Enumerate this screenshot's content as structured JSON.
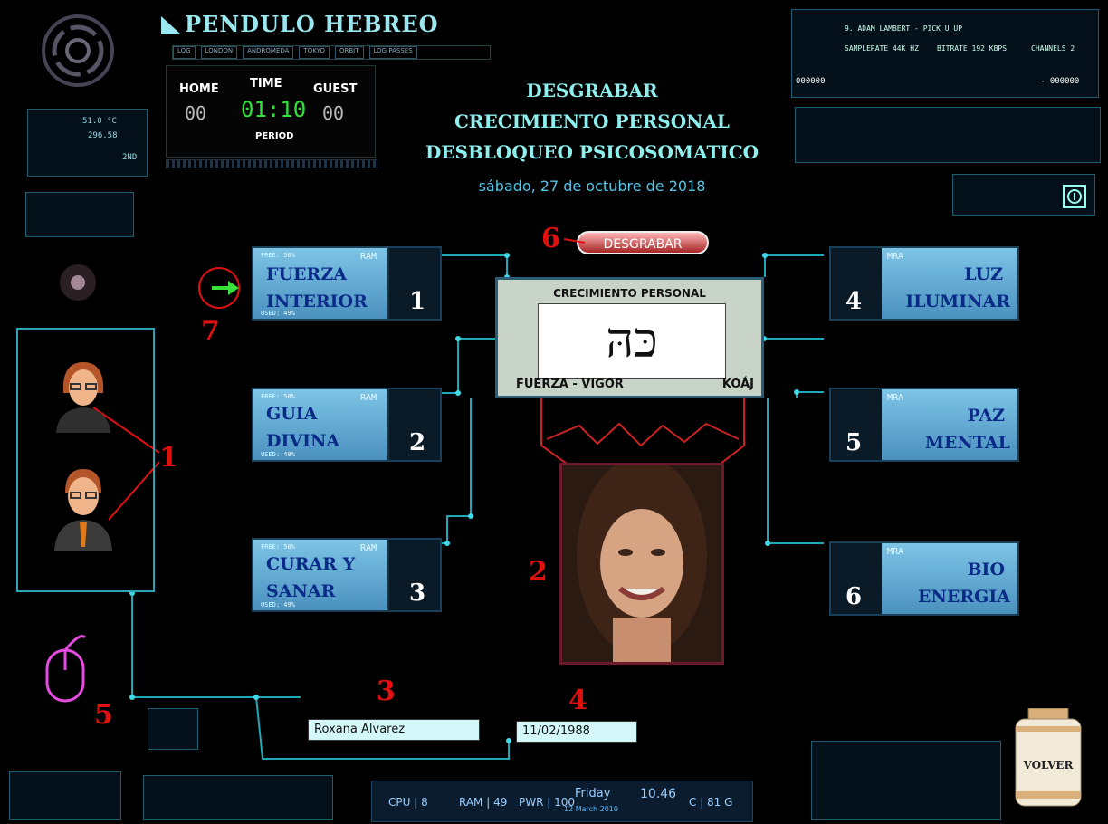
{
  "app": {
    "title": "PENDULO HEBREO",
    "menu": [
      "LOG",
      "LONDON",
      "ANDROMEDA",
      "TOKYO",
      "ORBIT",
      "LOG PASSES"
    ]
  },
  "scoreboard": {
    "home_label": "HOME",
    "time_label": "TIME",
    "guest_label": "GUEST",
    "home_value": "00",
    "time_value": "01:10",
    "guest_value": "00",
    "period_label": "PERIOD"
  },
  "header": {
    "line1": "DESGRABAR",
    "line2": "CRECIMIENTO PERSONAL",
    "line3": "DESBLOQUEO PSICOSOMATICO",
    "date": "sábado, 27 de octubre de 2018"
  },
  "desgrabar_button": "DESGRABAR",
  "center_card": {
    "title": "CRECIMIENTO PERSONAL",
    "hebrew": "כּהּ",
    "left_label": "FUERZA - VIGOR",
    "right_label": "KOÁJ"
  },
  "cards_left": [
    {
      "line1": "FUERZA",
      "line2": "INTERIOR",
      "number": "1",
      "tag_top": "FREE: 50%",
      "tag_bottom": "USED: 49%",
      "ram": "RAM"
    },
    {
      "line1": "GUIA",
      "line2": "DIVINA",
      "number": "2",
      "tag_top": "FREE: 50%",
      "tag_bottom": "USED: 49%",
      "ram": "RAM"
    },
    {
      "line1": "CURAR Y",
      "line2": "SANAR",
      "number": "3",
      "tag_top": "FREE: 50%",
      "tag_bottom": "USED: 49%",
      "ram": "RAM"
    }
  ],
  "cards_right": [
    {
      "line1": "LUZ",
      "line2": "ILUMINAR",
      "number": "4",
      "ram": "MRA"
    },
    {
      "line1": "PAZ",
      "line2": "MENTAL",
      "number": "5",
      "ram": "MRA"
    },
    {
      "line1": "BIO",
      "line2": "ENERGIA",
      "number": "6",
      "ram": "MRA"
    }
  ],
  "fields": {
    "name": "Roxana Alvarez",
    "dob": "11/02/1988"
  },
  "annotations": [
    "1",
    "2",
    "3",
    "4",
    "5",
    "6",
    "7"
  ],
  "player": {
    "track": "9. ADAM LAMBERT - PICK U UP",
    "samplerate": "SAMPLERATE 44K HZ",
    "bitrate": "BITRATE 192 KBPS",
    "channels": "CHANNELS 2",
    "time_left": "000000",
    "time_right": "- 000000"
  },
  "system": {
    "temp": "51.0 °C",
    "value": "296.58",
    "mode": "2ND"
  },
  "taskbar": {
    "cpu": "CPU | 8",
    "ram": "RAM | 49",
    "pwr": "PWR | 100",
    "day": "Friday",
    "date": "12 March 2010",
    "time": "10.46",
    "storage": "C | 81 G"
  },
  "volver": "VOLVER",
  "colors": {
    "accent": "#7fe3ea",
    "annotation": "#e01010",
    "card": "#5aa7cc"
  }
}
